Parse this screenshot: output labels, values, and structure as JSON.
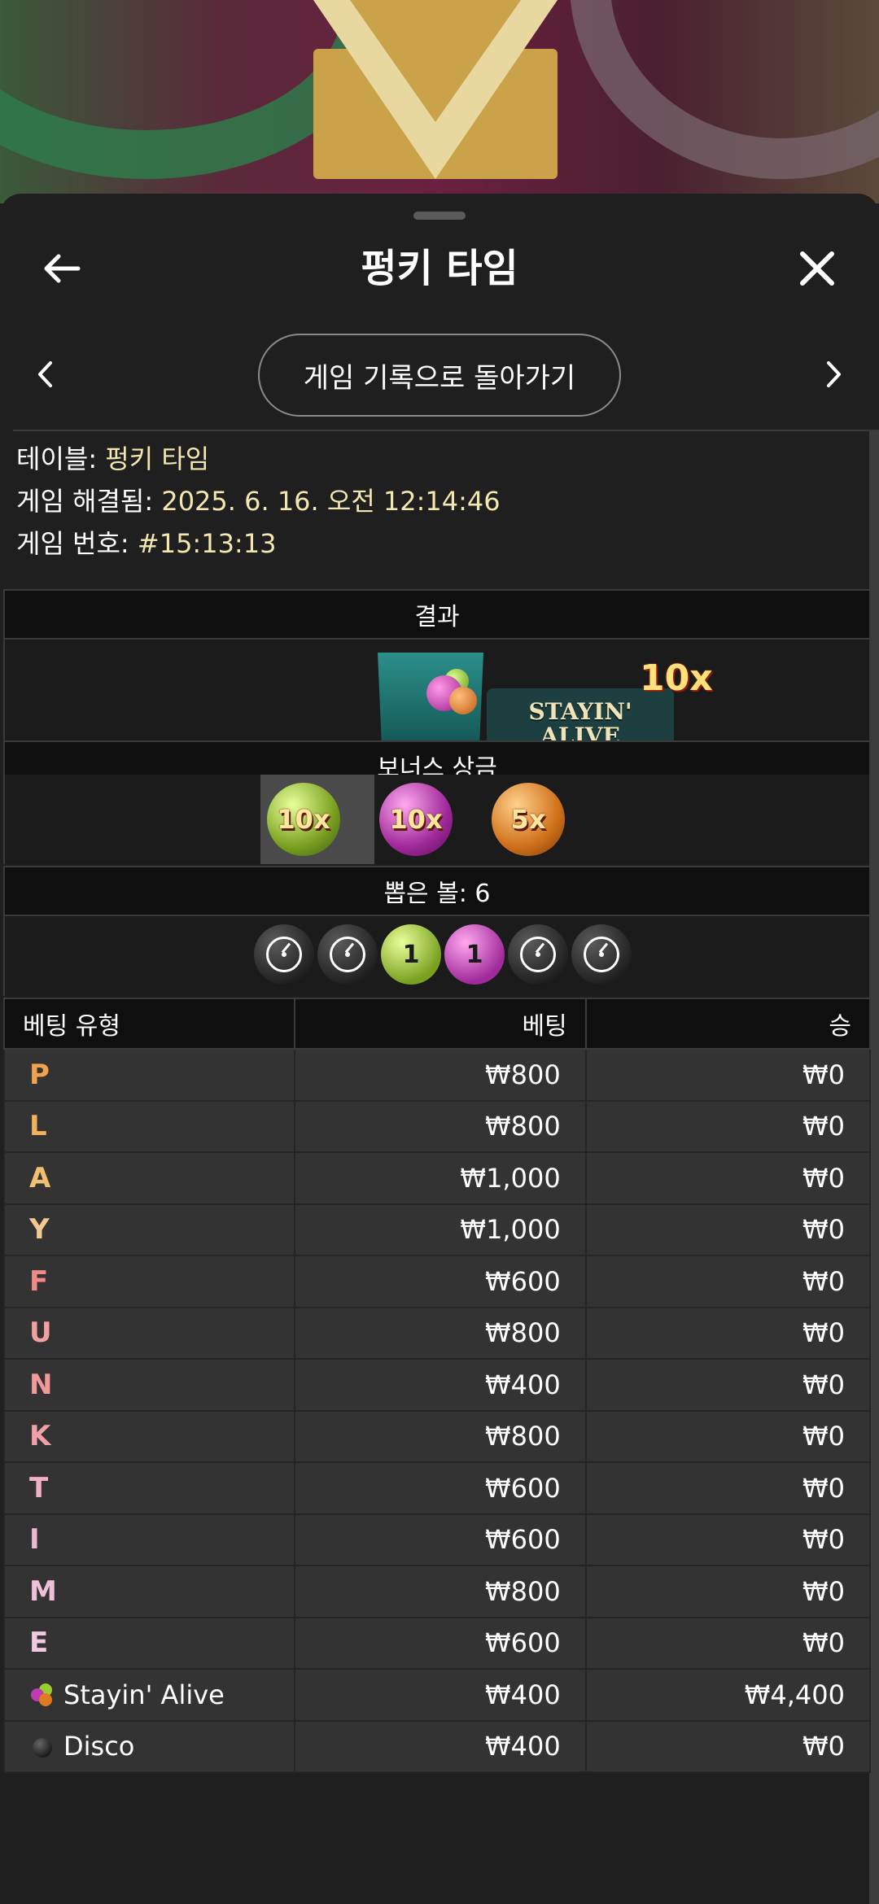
{
  "header": {
    "title": "펑키 타임"
  },
  "navigation": {
    "history_button": "게임 기록으로 돌아가기"
  },
  "info": [
    {
      "label": "테이블: ",
      "value": "펑키 타임"
    },
    {
      "label": "게임 해결됨: ",
      "value": "2025. 6. 16. 오전 12:14:46"
    },
    {
      "label": "게임 번호: ",
      "value": "#15:13:13"
    }
  ],
  "result": {
    "header": "결과",
    "segment_label": "STAYIN' ALIVE",
    "segment_label_line1": "STAYIN'",
    "segment_label_line2": "ALIVE",
    "multiplier": "10x"
  },
  "bonus": {
    "header": "보너스 상금",
    "balls": [
      {
        "label": "10x",
        "color": "green"
      },
      {
        "label": "10x",
        "color": "purple"
      },
      {
        "label": "5x",
        "color": "orange"
      }
    ]
  },
  "drawn": {
    "header": "뽑은 볼: 6",
    "balls": [
      {
        "type": "disc-icon",
        "label": ""
      },
      {
        "type": "disc-icon",
        "label": ""
      },
      {
        "type": "green",
        "label": "1"
      },
      {
        "type": "purple",
        "label": "1"
      },
      {
        "type": "disc-icon",
        "label": ""
      },
      {
        "type": "disc-icon",
        "label": ""
      }
    ]
  },
  "bets_table": {
    "columns": [
      "베팅 유형",
      "베팅",
      "승"
    ],
    "rows": [
      {
        "type": "P",
        "color": "#f2a24a",
        "bet": "₩800",
        "win": "₩0"
      },
      {
        "type": "L",
        "color": "#f2b05a",
        "bet": "₩800",
        "win": "₩0"
      },
      {
        "type": "A",
        "color": "#f0c070",
        "bet": "₩1,000",
        "win": "₩0"
      },
      {
        "type": "Y",
        "color": "#f2c890",
        "bet": "₩1,000",
        "win": "₩0"
      },
      {
        "type": "F",
        "color": "#f08a8a",
        "bet": "₩600",
        "win": "₩0"
      },
      {
        "type": "U",
        "color": "#f2a0a0",
        "bet": "₩800",
        "win": "₩0"
      },
      {
        "type": "N",
        "color": "#f29a9a",
        "bet": "₩400",
        "win": "₩0"
      },
      {
        "type": "K",
        "color": "#f0a0a8",
        "bet": "₩800",
        "win": "₩0"
      },
      {
        "type": "T",
        "color": "#f0b0c8",
        "bet": "₩600",
        "win": "₩0"
      },
      {
        "type": "I",
        "color": "#f0b8d0",
        "bet": "₩600",
        "win": "₩0"
      },
      {
        "type": "M",
        "color": "#f0c0d8",
        "bet": "₩800",
        "win": "₩0"
      },
      {
        "type": "E",
        "color": "#f0c8e0",
        "bet": "₩600",
        "win": "₩0"
      },
      {
        "type": "Stayin' Alive",
        "color": "",
        "bet": "₩400",
        "win": "₩4,400"
      },
      {
        "type": "Disco",
        "color": "",
        "bet": "₩400",
        "win": "₩0"
      }
    ]
  }
}
